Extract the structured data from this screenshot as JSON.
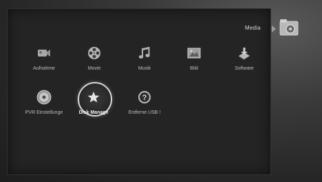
{
  "header": {
    "category_label": "Media"
  },
  "menu": {
    "items": [
      {
        "label": "Aufnahme",
        "icon": "camera-icon"
      },
      {
        "label": "Movie",
        "icon": "film-reel-icon"
      },
      {
        "label": "Musik",
        "icon": "music-note-icon"
      },
      {
        "label": "Bild",
        "icon": "picture-icon"
      },
      {
        "label": "Software",
        "icon": "software-install-icon"
      },
      {
        "label": "PVR Einstellunge",
        "icon": "disc-icon"
      },
      {
        "label": "Disk Manage",
        "icon": "star-icon",
        "selected": true
      },
      {
        "label": "Entferne USB !",
        "icon": "question-icon"
      }
    ]
  },
  "colors": {
    "background": "#1c1c1c",
    "panel": "#242424",
    "text": "#bfbfbf",
    "selected": "#f2f2f2"
  }
}
